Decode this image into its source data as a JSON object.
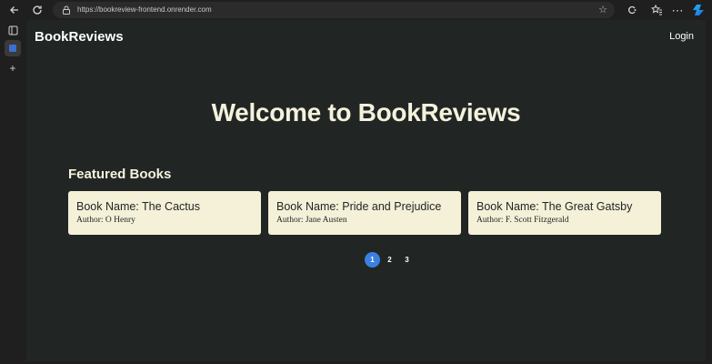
{
  "browser": {
    "url": "https://bookreview-frontend.onrender.com"
  },
  "header": {
    "brand": "BookReviews",
    "login": "Login"
  },
  "hero": {
    "title": "Welcome to BookReviews"
  },
  "featured": {
    "heading": "Featured Books",
    "books": [
      {
        "name": "Book Name: The Cactus",
        "author": "Author: O Henry"
      },
      {
        "name": "Book Name: Pride and Prejudice",
        "author": "Author: Jane Austen"
      },
      {
        "name": "Book Name: The Great Gatsby",
        "author": "Author: F. Scott Fitzgerald"
      }
    ]
  },
  "pagination": {
    "pages": [
      "1",
      "2",
      "3"
    ],
    "current": "1"
  },
  "colors": {
    "page_bg": "#212625",
    "card_bg": "#f4f1d8",
    "accent": "#3b7fe1",
    "title_text": "#f5f2dc"
  }
}
